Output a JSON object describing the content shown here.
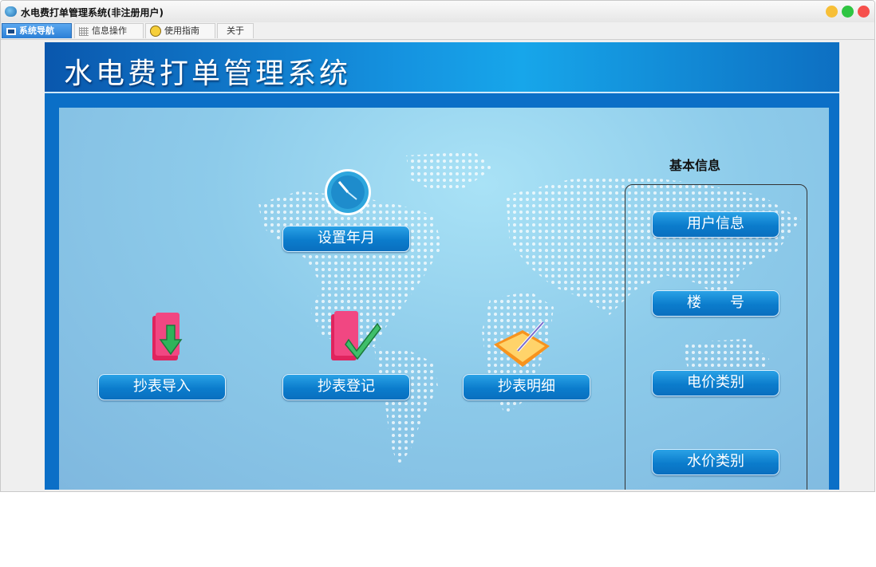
{
  "window": {
    "title": "水电费打单管理系统(非注册用户)"
  },
  "tabs": [
    {
      "label": "系统导航",
      "icon": "monitor-icon",
      "active": true
    },
    {
      "label": "信息操作",
      "icon": "grid-icon",
      "active": false
    },
    {
      "label": "使用指南",
      "icon": "clock-icon",
      "active": false
    },
    {
      "label": "关于",
      "icon": "",
      "active": false
    }
  ],
  "header": {
    "title": "水电费打单管理系统"
  },
  "main": {
    "set_month_label": "设置年月",
    "import_label": "抄表导入",
    "register_label": "抄表登记",
    "detail_label": "抄表明细"
  },
  "sidebar": {
    "title": "基本信息",
    "user_info_label": "用户信息",
    "building_label": "楼　　号",
    "electric_label": "电价类别",
    "water_label": "水价类别"
  },
  "colors": {
    "accent": "#0b7ccc",
    "header": "#1593e0",
    "panel": "#8dcbea"
  }
}
